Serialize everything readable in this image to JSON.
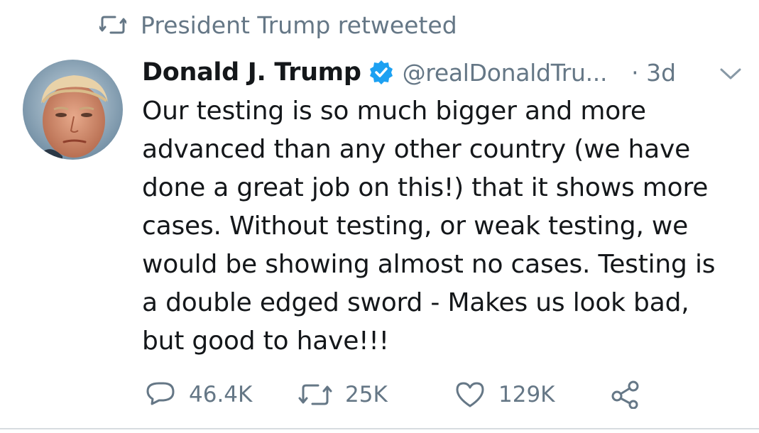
{
  "retweet_banner": {
    "text": "President Trump retweeted",
    "icon": "retweet-icon"
  },
  "author": {
    "name": "Donald J. Trump",
    "handle": "@realDonaldTru...",
    "time": "· 3d",
    "verified": true,
    "verified_color": "#1da1f2"
  },
  "tweet": {
    "lines": [
      "Our testing is so much bigger and more",
      "advanced than any other country (we have",
      "done a great job on this!) that it shows more",
      "cases. Without testing, or weak testing, we",
      "would be showing almost no cases. Testing is",
      "a double edged sword - Makes us look bad,",
      "but good to have!!!"
    ]
  },
  "actions": {
    "replies": "46.4K",
    "retweets": "25K",
    "likes": "129K"
  },
  "colors": {
    "text": "#14171a",
    "secondary": "#657786",
    "divider": "#d7dce0"
  }
}
